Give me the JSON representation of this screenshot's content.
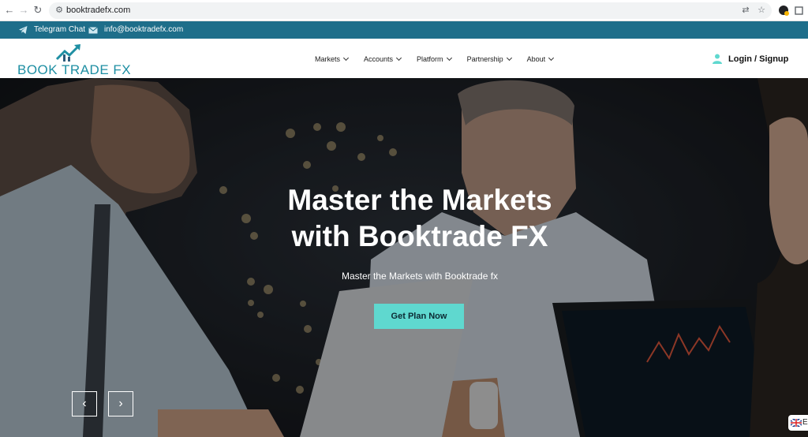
{
  "browser": {
    "url": "booktradefx.com",
    "back_icon": "arrow-left-icon",
    "forward_icon": "arrow-right-icon",
    "reload_icon": "reload-icon"
  },
  "topbar": {
    "telegram_label": "Telegram Chat",
    "email_label": "info@booktradefx.com",
    "background": "#1e6e8a"
  },
  "header": {
    "logo_text": "BOOK TRADE FX",
    "menu": [
      {
        "label": "Markets"
      },
      {
        "label": "Accounts"
      },
      {
        "label": "Platform"
      },
      {
        "label": "Partnership"
      },
      {
        "label": "About"
      }
    ],
    "login_label": "Login / Signup"
  },
  "hero": {
    "title_line1": "Master the Markets",
    "title_line2": "with Booktrade FX",
    "subtitle": "Master the Markets with Booktrade fx",
    "cta_label": "Get Plan Now",
    "cta_color": "#5fd8cf",
    "prev_icon": "chevron-left-icon",
    "next_icon": "chevron-right-icon"
  },
  "language": {
    "flag_icon": "uk-flag-icon",
    "letter": "E"
  }
}
